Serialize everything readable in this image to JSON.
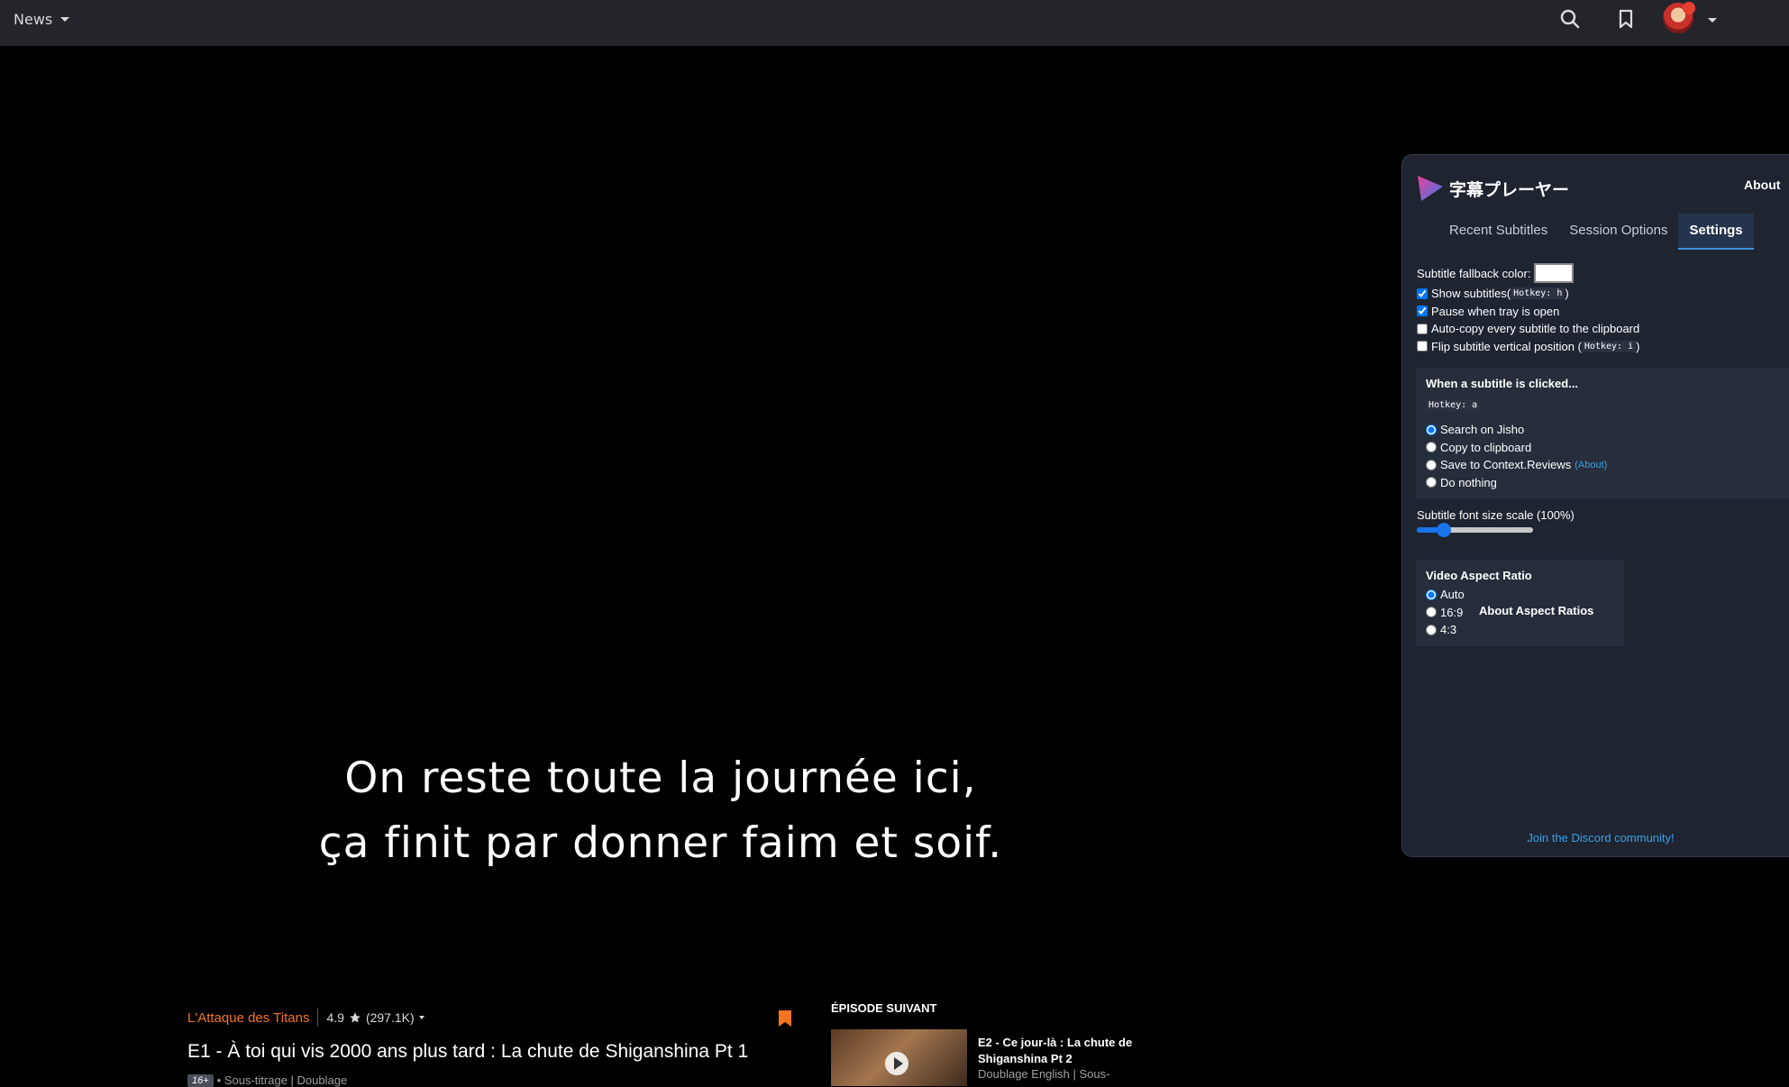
{
  "nav": {
    "news_label": "News"
  },
  "video": {
    "subtitle_line1": "On reste toute la journée ici,",
    "subtitle_line2": "ça finit par donner faim et soif."
  },
  "episode": {
    "series": "L'Attaque des Titans",
    "rating": "4.9",
    "rating_count": "(297.1K)",
    "title": "E1 - À toi qui vis 2000 ans plus tard : La chute de Shiganshina Pt 1",
    "age": "16+",
    "meta": "• Sous-titrage | Doublage"
  },
  "next": {
    "label": "ÉPISODE SUIVANT",
    "title": "E2 - Ce jour-là : La chute de Shiganshina Pt 2",
    "sub": "Doublage English | Sous-"
  },
  "panel": {
    "app_title": "字幕プレーヤー",
    "about": "About",
    "tabs": [
      "Recent Subtitles",
      "Session Options",
      "Settings"
    ],
    "fallback_color_label": "Subtitle fallback color:",
    "show_subtitles": "Show subtitles(",
    "hotkey_h": "Hotkey: h",
    "pause_tray": "Pause when tray is open",
    "auto_copy": "Auto-copy every subtitle to the clipboard",
    "flip": "Flip subtitle vertical position (",
    "hotkey_i": "Hotkey: i",
    "close_paren": ")",
    "click_heading": "When a subtitle is clicked...",
    "hotkey_a": "Hotkey: a",
    "click_options": [
      "Search on Jisho",
      "Copy to clipboard",
      "Save to Context.Reviews",
      "Do nothing"
    ],
    "about_small": "(About)",
    "font_scale": "Subtitle font size scale (100%)",
    "font_scale_value": 0.2,
    "aspect_heading": "Video Aspect Ratio",
    "aspect_options": [
      "Auto",
      "16:9",
      "4:3"
    ],
    "aspect_about": "About Aspect Ratios",
    "discord": "Join the Discord community!"
  },
  "colors": {
    "accent": "#f47521",
    "link": "#3aa0e8",
    "panel_bg": "#1e2430"
  }
}
